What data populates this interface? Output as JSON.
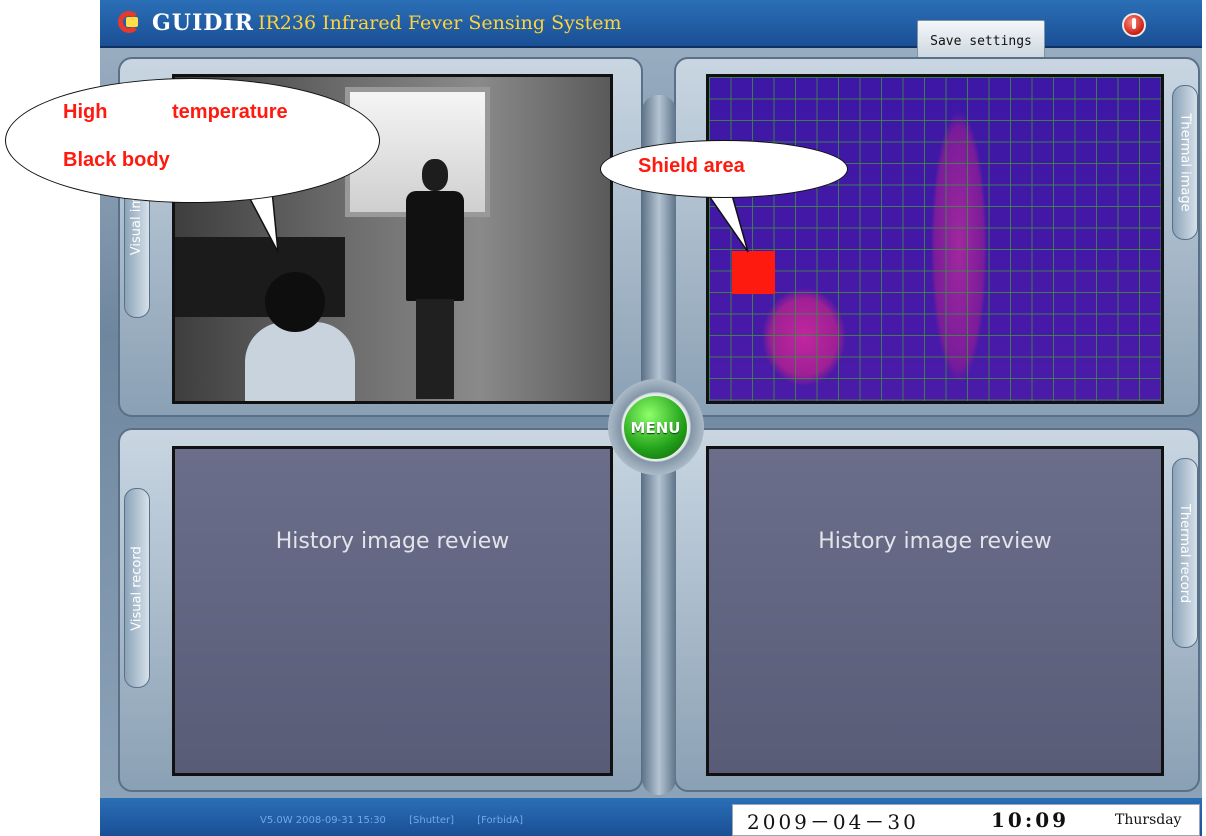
{
  "app": {
    "logo_text": "GUIDIR",
    "title": "IR236 Infrared Fever Sensing System",
    "save_label": "Save settings",
    "menu_label": "MENU"
  },
  "panels": {
    "visual_image_tab": "Visual image",
    "thermal_image_tab": "Thermal image",
    "visual_record_tab": "Visual record",
    "thermal_record_tab": "Thermal record",
    "history_left": "History image review",
    "history_right": "History image review"
  },
  "status": {
    "version": "V5.0W 2008-09-31 15:30",
    "shutter": "[Shutter]",
    "forbid": "[ForbidA]",
    "date": "2009－04－30",
    "time": "10:09",
    "day": "Thursday"
  },
  "callouts": {
    "high": "High",
    "temperature": "temperature",
    "black_body": "Black body",
    "shield_area": "Shield area"
  },
  "colors": {
    "title_bar": "#1f5aa3",
    "title_text": "#ffd33a",
    "shield_block": "#ff1a10",
    "menu_button": "#22a11a",
    "callout_text": "#ff1a10"
  }
}
